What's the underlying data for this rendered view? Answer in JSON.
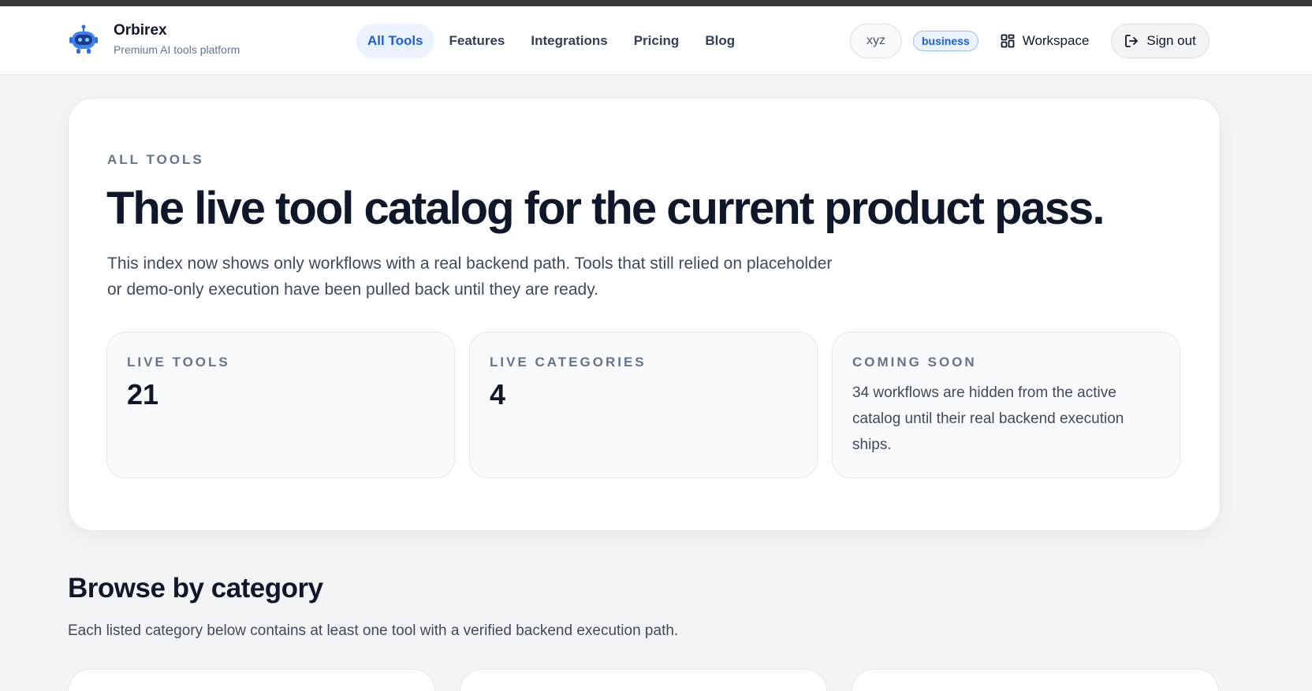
{
  "brand": {
    "name": "Orbirex",
    "tagline": "Premium AI tools platform"
  },
  "nav": {
    "links": [
      {
        "label": "All Tools",
        "active": true
      },
      {
        "label": "Features",
        "active": false
      },
      {
        "label": "Integrations",
        "active": false
      },
      {
        "label": "Pricing",
        "active": false
      },
      {
        "label": "Blog",
        "active": false
      }
    ]
  },
  "account": {
    "username": "xyz",
    "plan": "business",
    "workspace_label": "Workspace",
    "signout_label": "Sign out"
  },
  "hero": {
    "eyebrow": "ALL TOOLS",
    "title": "The live tool catalog for the current product pass.",
    "description": "This index now shows only workflows with a real backend path. Tools that still relied on placeholder or demo-only execution have been pulled back until they are ready.",
    "stats": [
      {
        "label": "LIVE TOOLS",
        "value": "21"
      },
      {
        "label": "LIVE CATEGORIES",
        "value": "4"
      },
      {
        "label": "COMING SOON",
        "text": "34 workflows are hidden from the active catalog until their real backend execution ships."
      }
    ]
  },
  "categories_section": {
    "title": "Browse by category",
    "description": "Each listed category below contains at least one tool with a verified backend execution path."
  },
  "colors": {
    "accent": "#1d5fd6",
    "accent_bg": "#eaf2fd",
    "page_bg": "#f3f4f6",
    "text_dark": "#0f172a",
    "text_muted": "#64748b"
  },
  "icons": {
    "brand": "robot-logo-icon",
    "workspace": "grid-icon",
    "signout": "sign-out-icon"
  }
}
